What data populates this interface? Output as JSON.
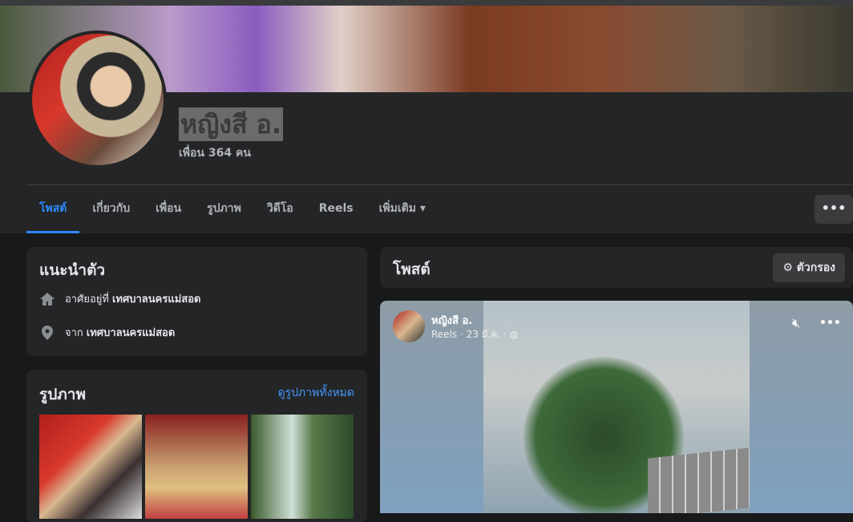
{
  "profile": {
    "name": "หญิงสี อ.",
    "friends": "เพื่อน 364 คน"
  },
  "tabs": [
    {
      "label": "โพสต์"
    },
    {
      "label": "เกี่ยวกับ"
    },
    {
      "label": "เพื่อน"
    },
    {
      "label": "รูปภาพ"
    },
    {
      "label": "วิดีโอ"
    },
    {
      "label": "Reels"
    },
    {
      "label": "เพิ่มเติม ▾"
    }
  ],
  "more_label": "•••",
  "intro": {
    "title": "แนะนำตัว",
    "lives_prefix": "อาศัยอยู่ที่",
    "lives": "เทศบาลนครแม่สอด",
    "from_prefix": "จาก",
    "from": "เทศบาลนครแม่สอด"
  },
  "photos": {
    "title": "รูปภาพ",
    "see_all": "ดูรูปภาพทั้งหมด"
  },
  "posts": {
    "title": "โพสต์",
    "filter": "ตัวกรอง"
  },
  "post": {
    "author": "หญิงสี อ.",
    "meta": "Reels · 23 มี.ค. ·",
    "options": "•••"
  },
  "colors": {
    "accent": "#2d88ff",
    "link": "#4599ff"
  }
}
